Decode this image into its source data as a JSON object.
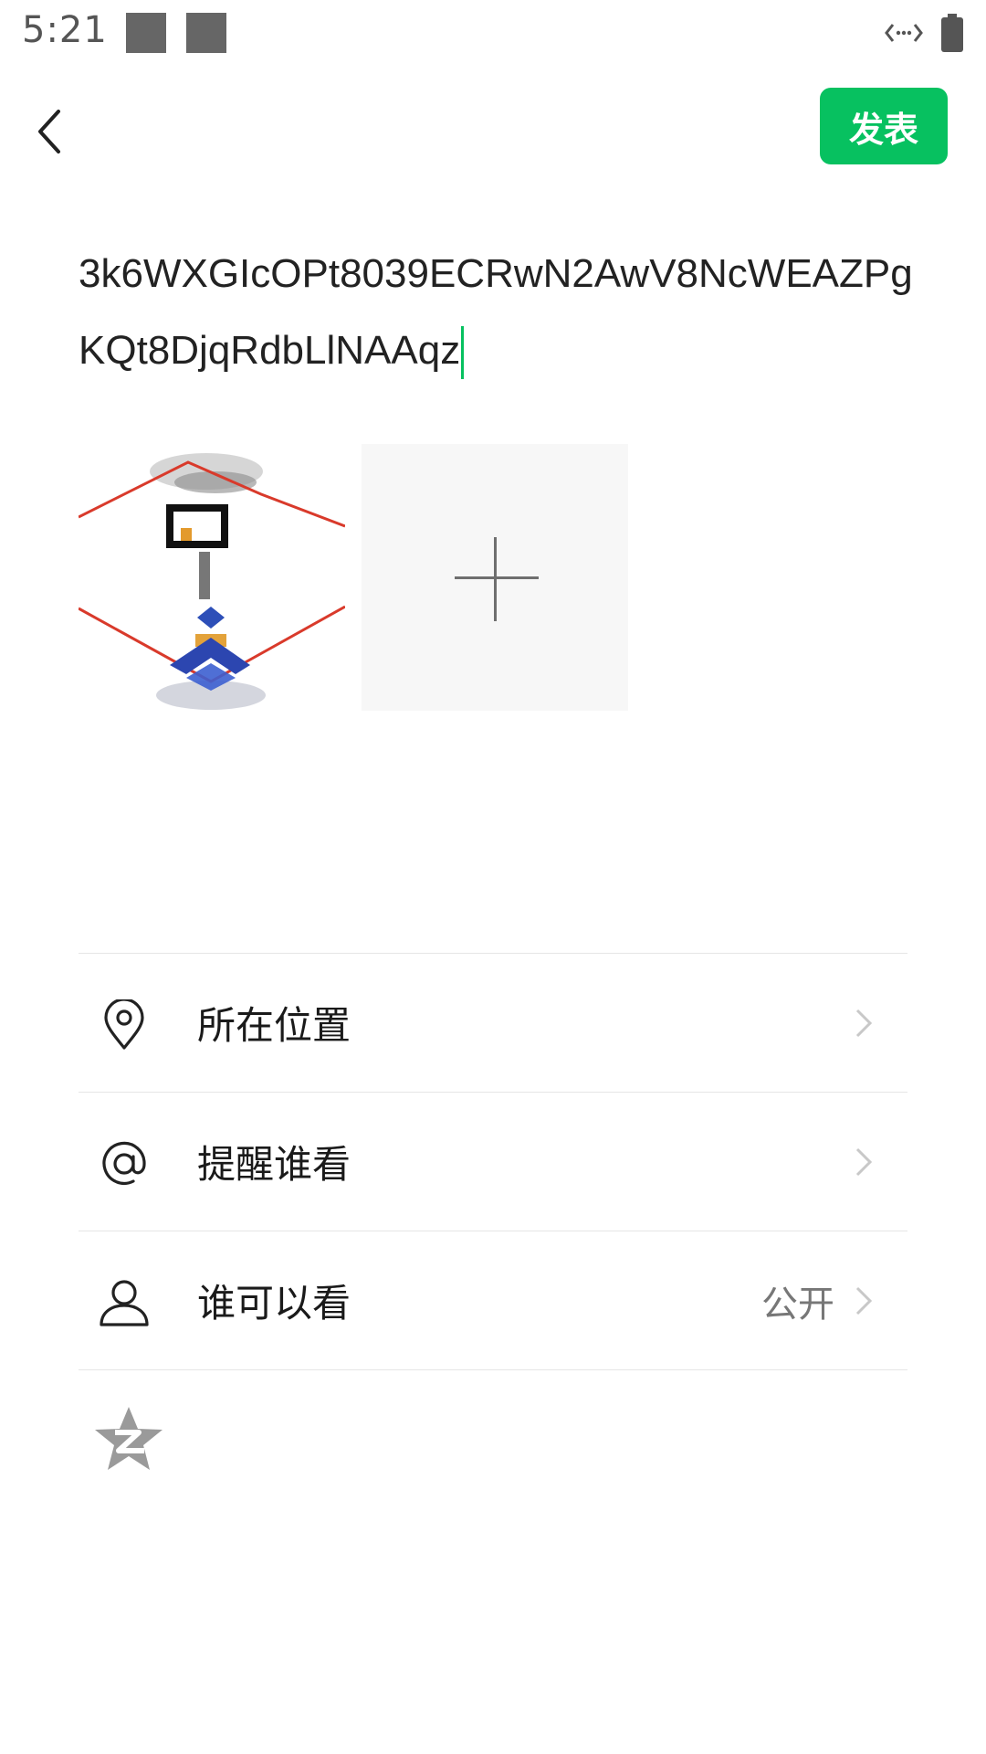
{
  "status_bar": {
    "time": "5:21",
    "icons": [
      "notification-square-icon",
      "notification-square-icon",
      "data-transfer-icon",
      "battery-icon"
    ]
  },
  "nav": {
    "back_icon": "chevron-left-icon",
    "publish_label": "发表",
    "accent_color": "#07c160"
  },
  "composer": {
    "text": "3k6WXGIcOPt8039ECRwN2AwV8NcWEAZPgKQt8DjqRdbLlNAAqz"
  },
  "images": {
    "attached_count": 1,
    "add_icon": "plus-icon"
  },
  "options": [
    {
      "icon": "location-pin-icon",
      "label": "所在位置",
      "value": ""
    },
    {
      "icon": "at-sign-icon",
      "label": "提醒谁看",
      "value": ""
    },
    {
      "icon": "person-icon",
      "label": "谁可以看",
      "value": "公开"
    }
  ],
  "share": {
    "icon": "qzone-star-icon"
  }
}
